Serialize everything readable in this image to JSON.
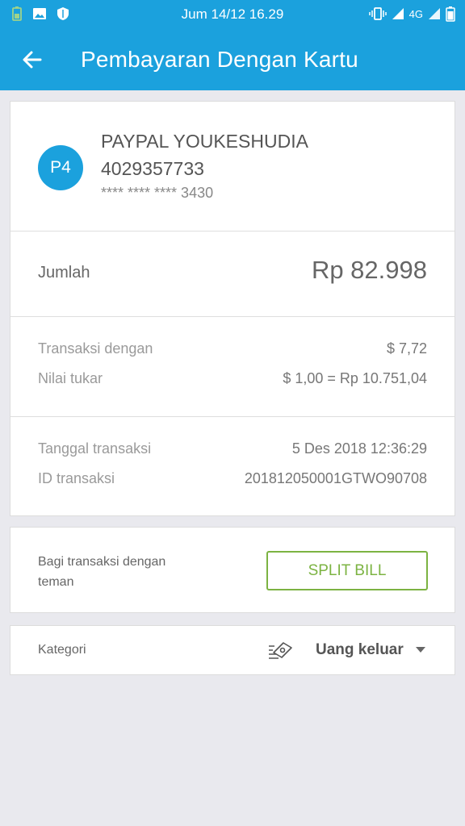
{
  "status_bar": {
    "time": "Jum 14/12 16.29",
    "network": "4G"
  },
  "header": {
    "title": "Pembayaran Dengan Kartu",
    "back_icon": "arrow-left-icon"
  },
  "account": {
    "avatar_initials": "P4",
    "name": "PAYPAL YOUKESHUDIA",
    "number": "4029357733",
    "card_masked": "**** **** **** 3430"
  },
  "amount": {
    "label": "Jumlah",
    "value": "Rp 82.998"
  },
  "exchange": {
    "transaction_label": "Transaksi dengan",
    "transaction_value": "$ 7,72",
    "rate_label": "Nilai tukar",
    "rate_value": "$ 1,00 = Rp 10.751,04"
  },
  "details": {
    "date_label": "Tanggal transaksi",
    "date_value": "5 Des 2018 12:36:29",
    "id_label": "ID transaksi",
    "id_value": "201812050001GTWO90708"
  },
  "split": {
    "text": "Bagi transaksi dengan teman",
    "button_label": "SPLIT BILL"
  },
  "category": {
    "label": "Kategori",
    "value": "Uang keluar",
    "icon": "money-out-icon"
  },
  "colors": {
    "primary": "#1ba1dd",
    "accent_green": "#7cb342",
    "background": "#e9e9ee"
  }
}
